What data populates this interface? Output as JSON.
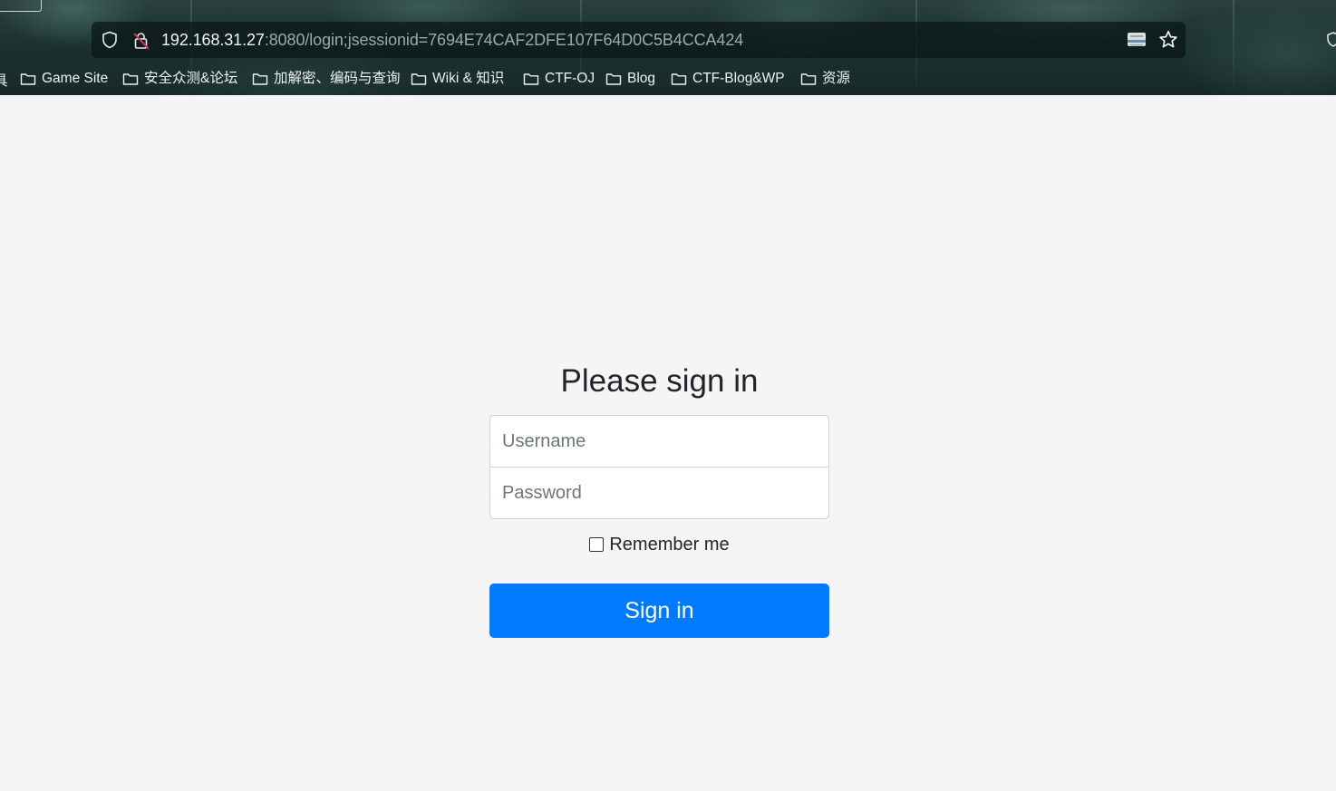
{
  "browser": {
    "url_host": "192.168.31.27",
    "url_path": ":8080/login;jsessionid=7694E74CAF2DFE107F64D0C5B4CCA424",
    "icons": [
      "shield-icon",
      "insecure-lock-icon",
      "reader-view-icon",
      "bookmark-star-icon"
    ],
    "bookmarks_cut_label": "具",
    "bookmarks": [
      {
        "label": "Game Site"
      },
      {
        "label": "安全众测&论坛"
      },
      {
        "label": "加解密、编码与查询"
      },
      {
        "label": "Wiki & 知识"
      },
      {
        "label": "CTF-OJ"
      },
      {
        "label": "Blog"
      },
      {
        "label": "CTF-Blog&WP"
      },
      {
        "label": "资源"
      }
    ]
  },
  "login": {
    "heading": "Please sign in",
    "username": {
      "placeholder": "Username",
      "value": ""
    },
    "password": {
      "placeholder": "Password",
      "value": ""
    },
    "remember_label": "Remember me",
    "remember_checked": false,
    "submit_label": "Sign in",
    "accent_color": "#007bff"
  }
}
